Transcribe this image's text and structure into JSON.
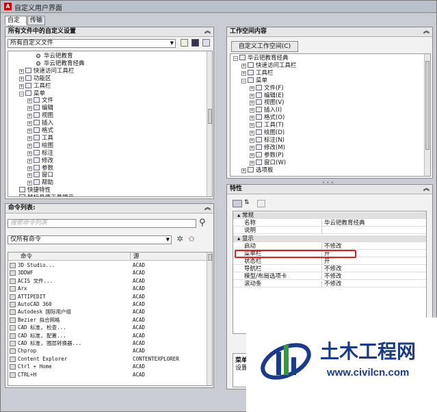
{
  "window": {
    "title": "自定义用户界面"
  },
  "tabs": [
    "自定义",
    "传输"
  ],
  "left_top": {
    "header": "所有文件中的自定义设置",
    "file_select": "所有自定义文件",
    "tree": [
      {
        "label": "华云钯教育",
        "indent": 3,
        "kind": "gear"
      },
      {
        "label": "华云钯教育经典",
        "indent": 3,
        "kind": "gear"
      },
      {
        "label": "快速访问工具栏",
        "indent": 1,
        "kind": "exp"
      },
      {
        "label": "功能区",
        "indent": 1,
        "kind": "exp"
      },
      {
        "label": "工具栏",
        "indent": 1,
        "kind": "exp"
      },
      {
        "label": "菜单",
        "indent": 1,
        "kind": "exp-open"
      },
      {
        "label": "文件",
        "indent": 2,
        "kind": "exp"
      },
      {
        "label": "编辑",
        "indent": 2,
        "kind": "exp"
      },
      {
        "label": "视图",
        "indent": 2,
        "kind": "exp"
      },
      {
        "label": "插入",
        "indent": 2,
        "kind": "exp"
      },
      {
        "label": "格式",
        "indent": 2,
        "kind": "exp"
      },
      {
        "label": "工具",
        "indent": 2,
        "kind": "exp"
      },
      {
        "label": "绘图",
        "indent": 2,
        "kind": "exp"
      },
      {
        "label": "标注",
        "indent": 2,
        "kind": "exp"
      },
      {
        "label": "修改",
        "indent": 2,
        "kind": "exp"
      },
      {
        "label": "参数",
        "indent": 2,
        "kind": "exp"
      },
      {
        "label": "窗口",
        "indent": 2,
        "kind": "exp"
      },
      {
        "label": "帮助",
        "indent": 2,
        "kind": "exp"
      },
      {
        "label": "快捷特性",
        "indent": 1,
        "kind": "plain"
      },
      {
        "label": "鼠标悬停工具提示",
        "indent": 1,
        "kind": "plain"
      }
    ]
  },
  "commands": {
    "header": "命令列表:",
    "search_placeholder": "搜索命令列表",
    "filter": "仅所有命令",
    "col_command": "命令",
    "col_source": "源",
    "rows": [
      [
        "3D Studio...",
        "ACAD"
      ],
      [
        "3DDWF",
        "ACAD"
      ],
      [
        "ACIS 文件...",
        "ACAD"
      ],
      [
        "Arx",
        "ACAD"
      ],
      [
        "ATTIPEDIT",
        "ACAD"
      ],
      [
        "AutoCAD 360",
        "ACAD"
      ],
      [
        "Autodesk 国际用户组",
        "ACAD"
      ],
      [
        "Bezier 拟合网格",
        "ACAD"
      ],
      [
        "CAD 标准, 检查...",
        "ACAD"
      ],
      [
        "CAD 标准, 配置...",
        "ACAD"
      ],
      [
        "CAD 标准, 图层转换器...",
        "ACAD"
      ],
      [
        "Chprop",
        "ACAD"
      ],
      [
        "Content Explorer",
        "CONTENTEXPLORER"
      ],
      [
        "Ctrl + Home",
        "ACAD"
      ],
      [
        "CTRL+H",
        "ACAD"
      ]
    ]
  },
  "workspace": {
    "header": "工作空间内容",
    "button": "自定义工作空间(C)",
    "tree": [
      {
        "label": "华云钯教育经典",
        "indent": 0,
        "kind": "exp-open"
      },
      {
        "label": "快速访问工具栏",
        "indent": 1,
        "kind": "exp"
      },
      {
        "label": "工具栏",
        "indent": 1,
        "kind": "exp"
      },
      {
        "label": "菜单",
        "indent": 1,
        "kind": "exp-open"
      },
      {
        "label": "文件(F)",
        "indent": 2,
        "kind": "exp"
      },
      {
        "label": "编辑(E)",
        "indent": 2,
        "kind": "exp"
      },
      {
        "label": "视图(V)",
        "indent": 2,
        "kind": "exp"
      },
      {
        "label": "插入(I)",
        "indent": 2,
        "kind": "exp"
      },
      {
        "label": "格式(O)",
        "indent": 2,
        "kind": "exp"
      },
      {
        "label": "工具(T)",
        "indent": 2,
        "kind": "exp"
      },
      {
        "label": "绘图(D)",
        "indent": 2,
        "kind": "exp"
      },
      {
        "label": "标注(N)",
        "indent": 2,
        "kind": "exp"
      },
      {
        "label": "修改(M)",
        "indent": 2,
        "kind": "exp"
      },
      {
        "label": "参数(P)",
        "indent": 2,
        "kind": "exp"
      },
      {
        "label": "窗口(W)",
        "indent": 2,
        "kind": "exp"
      },
      {
        "label": "选项板",
        "indent": 1,
        "kind": "exp"
      }
    ]
  },
  "properties": {
    "header": "特性",
    "group_general": "常规",
    "group_display": "显示",
    "general": [
      [
        "名称",
        "华云钯教育经典"
      ],
      [
        "说明",
        ""
      ]
    ],
    "display": [
      [
        "启动",
        "不修改"
      ],
      [
        "菜单栏",
        "开"
      ],
      [
        "状态栏",
        "开"
      ],
      [
        "导航栏",
        "不修改"
      ],
      [
        "模型/布局选项卡",
        "不修改"
      ],
      [
        "滚动条",
        "不修改"
      ]
    ],
    "desc_title": "菜单栏",
    "desc_text": "设置菜"
  },
  "watermark": {
    "brand": "土木工程网",
    "url": "www.civilcn.com",
    "colors": {
      "brand": "#1a3a8a",
      "accent": "#2e9e3a"
    }
  },
  "colors": {
    "highlight_border": "#e02020"
  }
}
